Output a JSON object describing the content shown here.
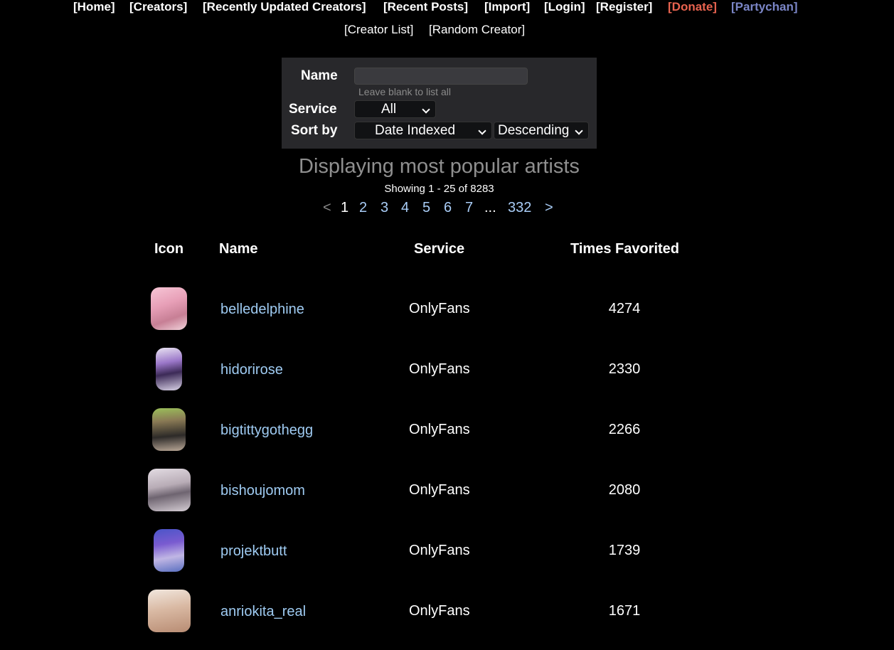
{
  "nav": {
    "home": "[Home]",
    "creators": "[Creators]",
    "recently_updated": "[Recently Updated Creators]",
    "recent_posts": "[Recent Posts]",
    "import": "[Import]",
    "login": "[Login]",
    "register": "[Register]",
    "donate": "[Donate]",
    "partychan": "[Partychan]",
    "creator_list": "[Creator List]",
    "random_creator": "[Random Creator]"
  },
  "colors": {
    "donate": "#e8634f",
    "partychan": "#7b86c7",
    "link": "#a9cdf7"
  },
  "search": {
    "name_label": "Name",
    "name_value": "",
    "name_hint": "Leave blank to list all",
    "service_label": "Service",
    "service_value": "All",
    "sortby_label": "Sort by",
    "sort_field": "Date Indexed",
    "sort_order": "Descending"
  },
  "headline": "Displaying most popular artists",
  "showing": "Showing 1 - 25 of 8283",
  "pagination": {
    "prev": "<",
    "current": "1",
    "pages": [
      "2",
      "3",
      "4",
      "5",
      "6",
      "7"
    ],
    "ellipsis": "...",
    "last": "332",
    "next": ">"
  },
  "table": {
    "headers": {
      "icon": "Icon",
      "name": "Name",
      "service": "Service",
      "favorited": "Times Favorited"
    },
    "rows": [
      {
        "name": "belledelphine",
        "service": "OnlyFans",
        "favorited": "4274"
      },
      {
        "name": "hidorirose",
        "service": "OnlyFans",
        "favorited": "2330"
      },
      {
        "name": "bigtittygothegg",
        "service": "OnlyFans",
        "favorited": "2266"
      },
      {
        "name": "bishoujomom",
        "service": "OnlyFans",
        "favorited": "2080"
      },
      {
        "name": "projektbutt",
        "service": "OnlyFans",
        "favorited": "1739"
      },
      {
        "name": "anriokita_real",
        "service": "OnlyFans",
        "favorited": "1671"
      }
    ]
  }
}
